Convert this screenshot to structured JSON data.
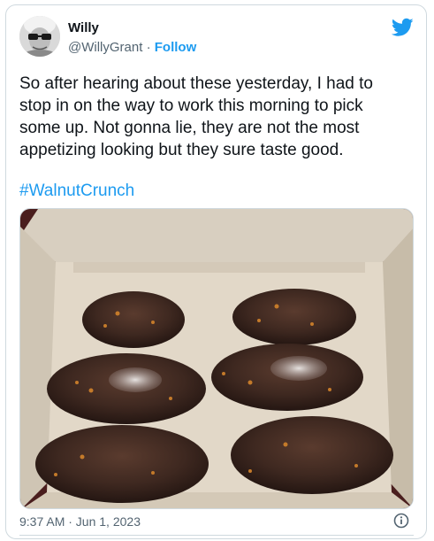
{
  "tweet": {
    "author_name": "Willy",
    "author_handle": "@WillyGrant",
    "separator": "·",
    "follow_label": "Follow",
    "text": "So after hearing about these yesterday, I had to stop in on the way to work this morning to pick some up.  Not gonna lie, they are not the most appetizing looking but they sure taste good.",
    "hashtag": "#WalnutCrunch",
    "timestamp": "9:37 AM · Jun 1, 2023"
  },
  "icons": {
    "brand": "twitter-bird-icon",
    "info": "info-icon"
  },
  "colors": {
    "accent": "#1d9bf0",
    "text": "#0f1419",
    "muted": "#536471",
    "border": "#cfd9de"
  }
}
